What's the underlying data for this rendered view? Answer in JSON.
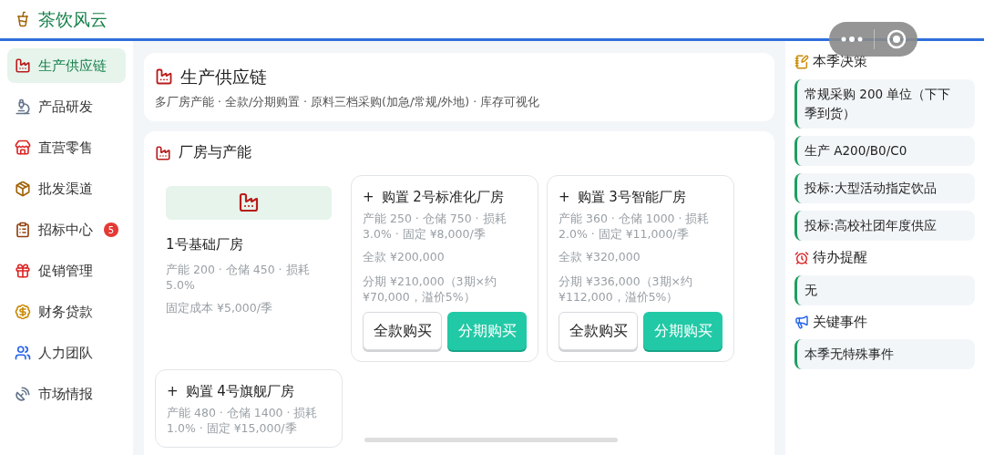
{
  "app": {
    "title": "茶饮风云"
  },
  "sidebar": {
    "items": [
      {
        "label": "生产供应链",
        "selected": true
      },
      {
        "label": "产品研发",
        "selected": false
      },
      {
        "label": "直营零售",
        "selected": false
      },
      {
        "label": "批发渠道",
        "selected": false
      },
      {
        "label": "招标中心",
        "selected": false,
        "badge": "5"
      },
      {
        "label": "促销管理",
        "selected": false
      },
      {
        "label": "财务贷款",
        "selected": false
      },
      {
        "label": "人力团队",
        "selected": false
      },
      {
        "label": "市场情报",
        "selected": false
      }
    ]
  },
  "header": {
    "title": "生产供应链",
    "subtitle": "多厂房产能 · 全款/分期购置 · 原料三档采购(加急/常规/外地) · 库存可视化"
  },
  "section": {
    "title": "厂房与产能",
    "factories": [
      {
        "kind": "owned",
        "name": "1号基础厂房",
        "specs": "产能 200 · 仓储 450 · 损耗 5.0%",
        "cost": "固定成本 ¥5,000/季"
      },
      {
        "kind": "purchasable",
        "plus": "+",
        "name": "购置 2号标准化厂房",
        "specs": "产能 250 · 仓储 750 · 损耗 3.0% · 固定 ¥8,000/季",
        "full": "全款 ¥200,000",
        "installment": "分期 ¥210,000（3期×约¥70,000，溢价5%）",
        "buttons": [
          "全款购买",
          "分期购买"
        ]
      },
      {
        "kind": "purchasable",
        "plus": "+",
        "name": "购置 3号智能厂房",
        "specs": "产能 360 · 仓储 1000 · 损耗 2.0% · 固定 ¥11,000/季",
        "full": "全款 ¥320,000",
        "installment": "分期 ¥336,000（3期×约¥112,000，溢价5%）",
        "buttons": [
          "全款购买",
          "分期购买"
        ]
      },
      {
        "kind": "purchasable",
        "plus": "+",
        "name": "购置 4号旗舰厂房",
        "specs": "产能 480 · 仓储 1400 · 损耗 1.0% · 固定 ¥15,000/季"
      }
    ]
  },
  "panel": {
    "sections": [
      {
        "title": "本季决策",
        "items": [
          "常规采购 200 单位（下下季到货）",
          "生产 A200/B0/C0",
          "投标:大型活动指定饮品",
          "投标:高校社团年度供应"
        ]
      },
      {
        "title": "待办提醒",
        "items": [
          "无"
        ]
      },
      {
        "title": "关键事件",
        "items": [
          "本季无特殊事件"
        ]
      }
    ]
  }
}
